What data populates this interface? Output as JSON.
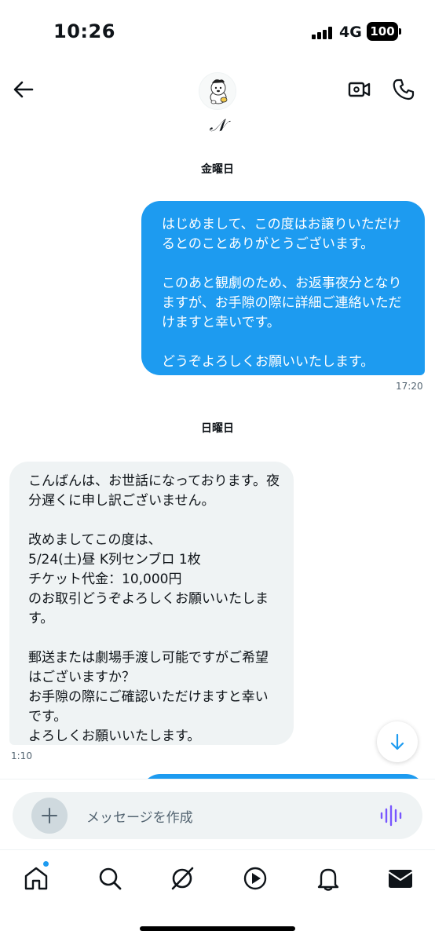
{
  "status_bar": {
    "time": "10:26",
    "network": "4G",
    "battery": "100"
  },
  "header": {
    "contact_name": "𝒩"
  },
  "chat": {
    "day1": "金曜日",
    "outgoing_message": "はじめまして、この度はお譲りいただけるとのことありがとうございます。\n\nこのあと観劇のため、お返事夜分となりますが、お手隙の際に詳細ご連絡いただけますと幸いです。\n\nどうぞよろしくお願いいたします。",
    "outgoing_time": "17:20",
    "day2": "日曜日",
    "incoming_message": "こんばんは、お世話になっております。夜分遅くに申し訳ございません。\n\n改めましてこの度は、\n5/24(土)昼 K列センブロ 1枚\nチケット代金：10,000円\nのお取引どうぞよろしくお願いいたします。\n\n郵送または劇場手渡し可能ですがご希望はございますか？\nお手隙の際にご確認いただけますと幸いです。\nよろしくお願いいたします。",
    "incoming_time": "1:10"
  },
  "composer": {
    "placeholder": "メッセージを作成"
  },
  "tabs": [
    {
      "icon": "home-icon"
    },
    {
      "icon": "search-icon"
    },
    {
      "icon": "grok-icon"
    },
    {
      "icon": "video-play-icon"
    },
    {
      "icon": "bell-icon"
    },
    {
      "icon": "mail-icon"
    }
  ],
  "colors": {
    "accent": "#1d9bf0",
    "bubble_in": "#eff3f4",
    "secondary_text": "#536471",
    "voice_icon": "#7856ff"
  }
}
